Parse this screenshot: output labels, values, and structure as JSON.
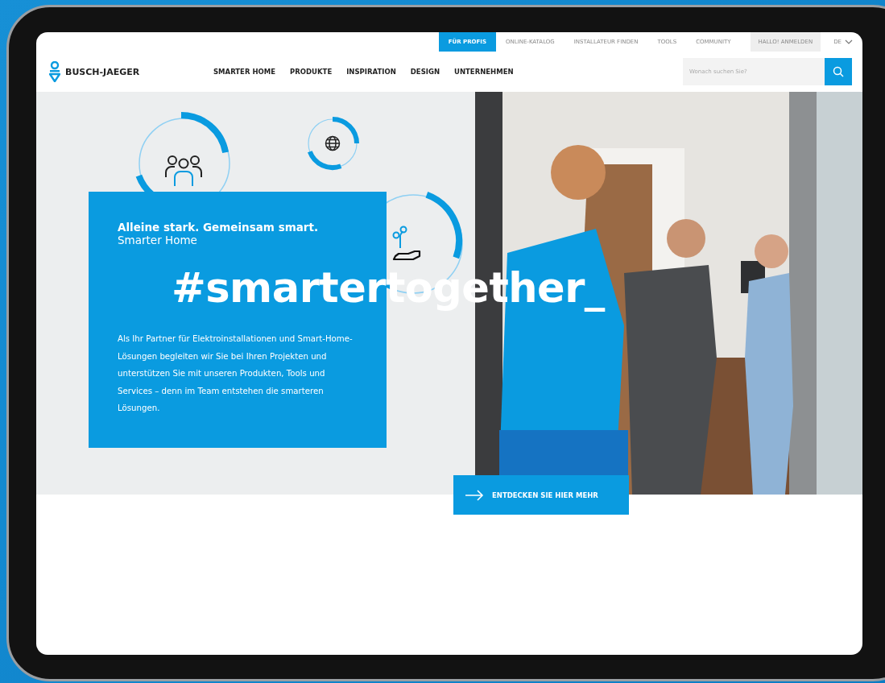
{
  "utility_nav": {
    "links": [
      {
        "label": "FÜR PROFIS",
        "selected": true
      },
      {
        "label": "ONLINE-KATALOG",
        "selected": false
      },
      {
        "label": "INSTALLATEUR FINDEN",
        "selected": false
      },
      {
        "label": "TOOLS",
        "selected": false
      },
      {
        "label": "COMMUNITY",
        "selected": false
      }
    ],
    "account": {
      "label": "HALLO! ANMELDEN"
    },
    "language": {
      "label": "DE"
    }
  },
  "header": {
    "logo": "BUSCH-JAEGER",
    "nav": [
      {
        "label": "SMARTER HOME"
      },
      {
        "label": "PRODUKTE"
      },
      {
        "label": "INSPIRATION"
      },
      {
        "label": "DESIGN"
      },
      {
        "label": "UNTERNEHMEN"
      }
    ],
    "search": {
      "placeholder": "Wonach suchen Sie?"
    }
  },
  "hero": {
    "headline": "Alleine stark. Gemeinsam smart.",
    "subline": "Smarter Home",
    "hashtag": "#smartertogether_",
    "body": "Als Ihr Partner für Elektroinstallationen und Smart-Home-Lösungen begleiten wir Sie bei Ihren Projekten und unterstützen Sie mit unseren Produkten, Tools und Services – denn im Team entstehen die smarteren Lösungen.",
    "button": "ENTDECKEN SIE HIER MEHR"
  }
}
